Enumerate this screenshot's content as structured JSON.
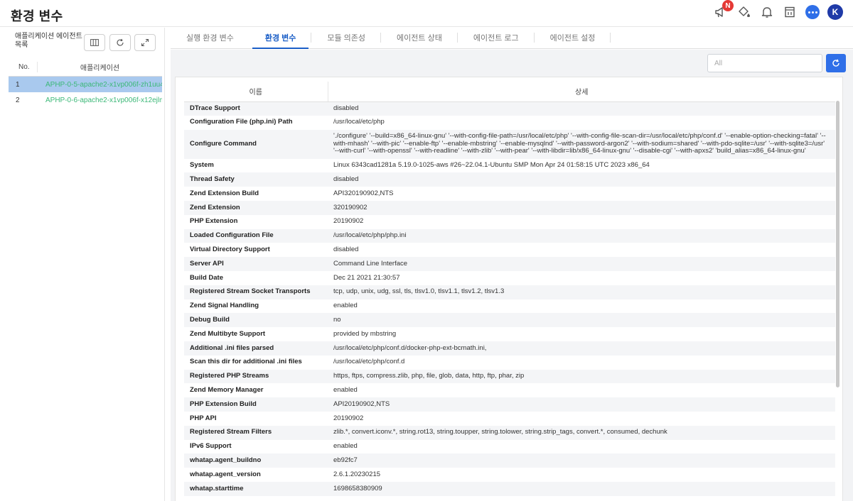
{
  "header": {
    "title": "환경 변수",
    "badge": "N",
    "avatar_initial": "K"
  },
  "left_panel": {
    "title": "애플리케이션 에이전트 목록",
    "table": {
      "col_no": "No.",
      "col_name": "애플리케이션",
      "rows": [
        {
          "no": "1",
          "name": "APHP-0-5-apache2-x1vp006f-zh1uu4l"
        },
        {
          "no": "2",
          "name": "APHP-0-6-apache2-x1vp006f-x12ejlm"
        }
      ]
    }
  },
  "tabs": [
    {
      "label": "실행 환경 변수"
    },
    {
      "label": "환경 변수"
    },
    {
      "label": "모듈 의존성"
    },
    {
      "label": "에이전트 상태"
    },
    {
      "label": "에이전트 로그"
    },
    {
      "label": "에이전트 설정"
    }
  ],
  "search": {
    "placeholder": "All"
  },
  "env_table": {
    "col_name": "이름",
    "col_detail": "상세",
    "rows": [
      {
        "k": "DTrace Support",
        "v": "disabled"
      },
      {
        "k": "Configuration File (php.ini) Path",
        "v": "/usr/local/etc/php"
      },
      {
        "k": "Configure Command",
        "v": "'./configure' '--build=x86_64-linux-gnu' '--with-config-file-path=/usr/local/etc/php' '--with-config-file-scan-dir=/usr/local/etc/php/conf.d' '--enable-option-checking=fatal' '--with-mhash' '--with-pic' '--enable-ftp' '--enable-mbstring' '--enable-mysqlnd' '--with-password-argon2' '--with-sodium=shared' '--with-pdo-sqlite=/usr' '--with-sqlite3=/usr' '--with-curl' '--with-openssl' '--with-readline' '--with-zlib' '--with-pear' '--with-libdir=lib/x86_64-linux-gnu' '--disable-cgi' '--with-apxs2' 'build_alias=x86_64-linux-gnu'"
      },
      {
        "k": "System",
        "v": "Linux 6343cad1281a 5.19.0-1025-aws #26~22.04.1-Ubuntu SMP Mon Apr 24 01:58:15 UTC 2023 x86_64"
      },
      {
        "k": "Thread Safety",
        "v": "disabled"
      },
      {
        "k": "Zend Extension Build",
        "v": "API320190902,NTS"
      },
      {
        "k": "Zend Extension",
        "v": "320190902"
      },
      {
        "k": "PHP Extension",
        "v": "20190902"
      },
      {
        "k": "Loaded Configuration File",
        "v": "/usr/local/etc/php/php.ini"
      },
      {
        "k": "Virtual Directory Support",
        "v": "disabled"
      },
      {
        "k": "Server API",
        "v": "Command Line Interface"
      },
      {
        "k": "Build Date",
        "v": "Dec 21 2021 21:30:57"
      },
      {
        "k": "Registered Stream Socket Transports",
        "v": "tcp, udp, unix, udg, ssl, tls, tlsv1.0, tlsv1.1, tlsv1.2, tlsv1.3"
      },
      {
        "k": "Zend Signal Handling",
        "v": "enabled"
      },
      {
        "k": "Debug Build",
        "v": "no"
      },
      {
        "k": "Zend Multibyte Support",
        "v": "provided by mbstring"
      },
      {
        "k": "Additional .ini files parsed",
        "v": "/usr/local/etc/php/conf.d/docker-php-ext-bcmath.ini,"
      },
      {
        "k": "Scan this dir for additional .ini files",
        "v": "/usr/local/etc/php/conf.d"
      },
      {
        "k": "Registered PHP Streams",
        "v": "https, ftps, compress.zlib, php, file, glob, data, http, ftp, phar, zip"
      },
      {
        "k": "Zend Memory Manager",
        "v": "enabled"
      },
      {
        "k": "PHP Extension Build",
        "v": "API20190902,NTS"
      },
      {
        "k": "PHP API",
        "v": "20190902"
      },
      {
        "k": "Registered Stream Filters",
        "v": "zlib.*, convert.iconv.*, string.rot13, string.toupper, string.tolower, string.strip_tags, convert.*, consumed, dechunk"
      },
      {
        "k": "IPv6 Support",
        "v": "enabled"
      },
      {
        "k": "whatap.agent_buildno",
        "v": "eb92fc7"
      },
      {
        "k": "whatap.agent_version",
        "v": "2.6.1.20230215"
      },
      {
        "k": "whatap.starttime",
        "v": "1698658380909"
      }
    ]
  },
  "colors": {
    "accent": "#2f6fe8",
    "active_tab": "#1a5ec7",
    "app_name": "#3cb878",
    "selected_row": "#a9c9ee",
    "badge": "#e53935",
    "avatar": "#1f3aa8"
  }
}
